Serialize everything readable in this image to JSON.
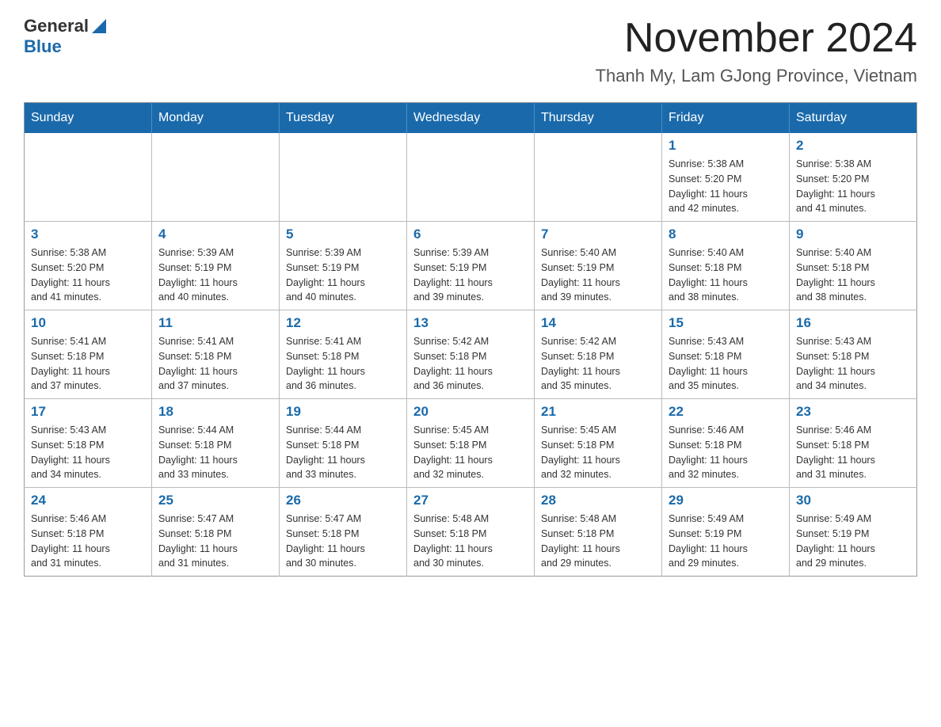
{
  "header": {
    "logo_general": "General",
    "logo_blue": "Blue",
    "main_title": "November 2024",
    "subtitle": "Thanh My, Lam GJong Province, Vietnam"
  },
  "calendar": {
    "days_of_week": [
      "Sunday",
      "Monday",
      "Tuesday",
      "Wednesday",
      "Thursday",
      "Friday",
      "Saturday"
    ],
    "weeks": [
      [
        {
          "day": "",
          "info": ""
        },
        {
          "day": "",
          "info": ""
        },
        {
          "day": "",
          "info": ""
        },
        {
          "day": "",
          "info": ""
        },
        {
          "day": "",
          "info": ""
        },
        {
          "day": "1",
          "info": "Sunrise: 5:38 AM\nSunset: 5:20 PM\nDaylight: 11 hours\nand 42 minutes."
        },
        {
          "day": "2",
          "info": "Sunrise: 5:38 AM\nSunset: 5:20 PM\nDaylight: 11 hours\nand 41 minutes."
        }
      ],
      [
        {
          "day": "3",
          "info": "Sunrise: 5:38 AM\nSunset: 5:20 PM\nDaylight: 11 hours\nand 41 minutes."
        },
        {
          "day": "4",
          "info": "Sunrise: 5:39 AM\nSunset: 5:19 PM\nDaylight: 11 hours\nand 40 minutes."
        },
        {
          "day": "5",
          "info": "Sunrise: 5:39 AM\nSunset: 5:19 PM\nDaylight: 11 hours\nand 40 minutes."
        },
        {
          "day": "6",
          "info": "Sunrise: 5:39 AM\nSunset: 5:19 PM\nDaylight: 11 hours\nand 39 minutes."
        },
        {
          "day": "7",
          "info": "Sunrise: 5:40 AM\nSunset: 5:19 PM\nDaylight: 11 hours\nand 39 minutes."
        },
        {
          "day": "8",
          "info": "Sunrise: 5:40 AM\nSunset: 5:18 PM\nDaylight: 11 hours\nand 38 minutes."
        },
        {
          "day": "9",
          "info": "Sunrise: 5:40 AM\nSunset: 5:18 PM\nDaylight: 11 hours\nand 38 minutes."
        }
      ],
      [
        {
          "day": "10",
          "info": "Sunrise: 5:41 AM\nSunset: 5:18 PM\nDaylight: 11 hours\nand 37 minutes."
        },
        {
          "day": "11",
          "info": "Sunrise: 5:41 AM\nSunset: 5:18 PM\nDaylight: 11 hours\nand 37 minutes."
        },
        {
          "day": "12",
          "info": "Sunrise: 5:41 AM\nSunset: 5:18 PM\nDaylight: 11 hours\nand 36 minutes."
        },
        {
          "day": "13",
          "info": "Sunrise: 5:42 AM\nSunset: 5:18 PM\nDaylight: 11 hours\nand 36 minutes."
        },
        {
          "day": "14",
          "info": "Sunrise: 5:42 AM\nSunset: 5:18 PM\nDaylight: 11 hours\nand 35 minutes."
        },
        {
          "day": "15",
          "info": "Sunrise: 5:43 AM\nSunset: 5:18 PM\nDaylight: 11 hours\nand 35 minutes."
        },
        {
          "day": "16",
          "info": "Sunrise: 5:43 AM\nSunset: 5:18 PM\nDaylight: 11 hours\nand 34 minutes."
        }
      ],
      [
        {
          "day": "17",
          "info": "Sunrise: 5:43 AM\nSunset: 5:18 PM\nDaylight: 11 hours\nand 34 minutes."
        },
        {
          "day": "18",
          "info": "Sunrise: 5:44 AM\nSunset: 5:18 PM\nDaylight: 11 hours\nand 33 minutes."
        },
        {
          "day": "19",
          "info": "Sunrise: 5:44 AM\nSunset: 5:18 PM\nDaylight: 11 hours\nand 33 minutes."
        },
        {
          "day": "20",
          "info": "Sunrise: 5:45 AM\nSunset: 5:18 PM\nDaylight: 11 hours\nand 32 minutes."
        },
        {
          "day": "21",
          "info": "Sunrise: 5:45 AM\nSunset: 5:18 PM\nDaylight: 11 hours\nand 32 minutes."
        },
        {
          "day": "22",
          "info": "Sunrise: 5:46 AM\nSunset: 5:18 PM\nDaylight: 11 hours\nand 32 minutes."
        },
        {
          "day": "23",
          "info": "Sunrise: 5:46 AM\nSunset: 5:18 PM\nDaylight: 11 hours\nand 31 minutes."
        }
      ],
      [
        {
          "day": "24",
          "info": "Sunrise: 5:46 AM\nSunset: 5:18 PM\nDaylight: 11 hours\nand 31 minutes."
        },
        {
          "day": "25",
          "info": "Sunrise: 5:47 AM\nSunset: 5:18 PM\nDaylight: 11 hours\nand 31 minutes."
        },
        {
          "day": "26",
          "info": "Sunrise: 5:47 AM\nSunset: 5:18 PM\nDaylight: 11 hours\nand 30 minutes."
        },
        {
          "day": "27",
          "info": "Sunrise: 5:48 AM\nSunset: 5:18 PM\nDaylight: 11 hours\nand 30 minutes."
        },
        {
          "day": "28",
          "info": "Sunrise: 5:48 AM\nSunset: 5:18 PM\nDaylight: 11 hours\nand 29 minutes."
        },
        {
          "day": "29",
          "info": "Sunrise: 5:49 AM\nSunset: 5:19 PM\nDaylight: 11 hours\nand 29 minutes."
        },
        {
          "day": "30",
          "info": "Sunrise: 5:49 AM\nSunset: 5:19 PM\nDaylight: 11 hours\nand 29 minutes."
        }
      ]
    ]
  }
}
